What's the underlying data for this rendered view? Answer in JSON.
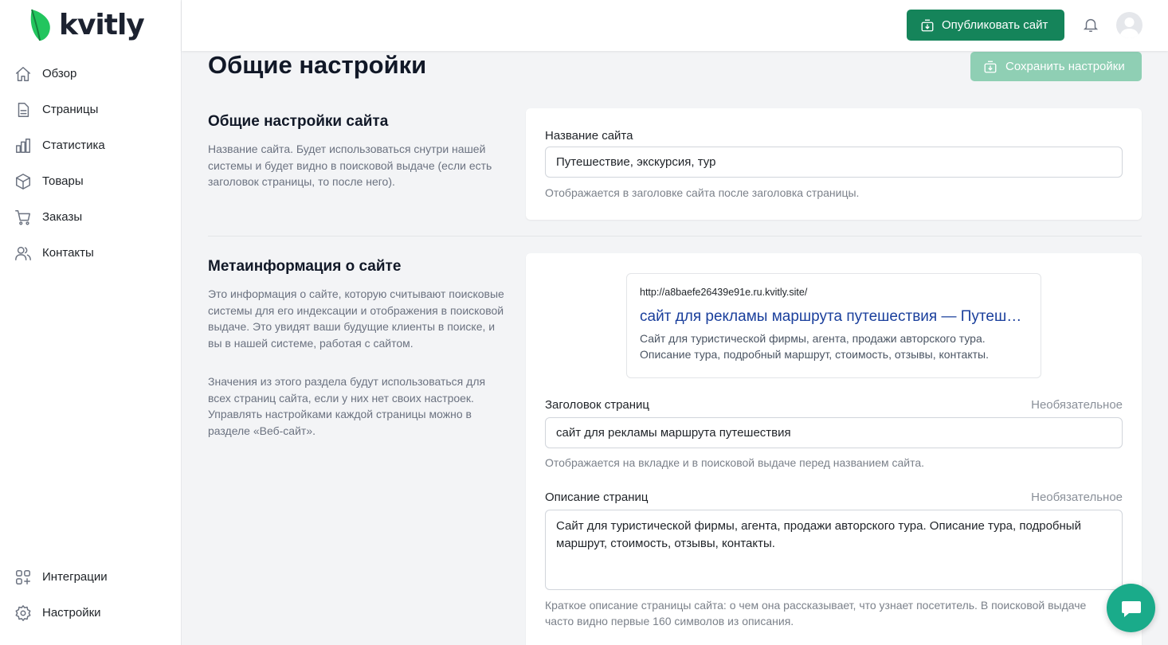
{
  "brand": {
    "name": "kvitly",
    "leaf_color": "#22c55e"
  },
  "sidebar": {
    "items": [
      {
        "label": "Обзор",
        "icon": "home-icon"
      },
      {
        "label": "Страницы",
        "icon": "document-icon"
      },
      {
        "label": "Статистика",
        "icon": "chart-icon"
      },
      {
        "label": "Товары",
        "icon": "box-icon"
      },
      {
        "label": "Заказы",
        "icon": "cart-icon"
      },
      {
        "label": "Контакты",
        "icon": "users-icon"
      }
    ],
    "bottom_items": [
      {
        "label": "Интеграции",
        "icon": "integrations-icon"
      },
      {
        "label": "Настройки",
        "icon": "gear-icon"
      }
    ]
  },
  "topbar": {
    "publish_label": "Опубликовать сайт",
    "accent": "#15845a"
  },
  "page": {
    "title": "Общие настройки",
    "save_label": "Сохранить настройки"
  },
  "general": {
    "title": "Общие настройки сайта",
    "description": "Название сайта. Будет использоваться снутри нашей системы и будет видно в поисковой выдаче (если есть заголовок страницы, то после него).",
    "site_name_label": "Название сайта",
    "site_name_value": "Путешествие, экскурсия, тур",
    "site_name_help": "Отображается в заголовке сайта после заголовка страницы."
  },
  "meta": {
    "title": "Метаинформация о сайте",
    "description_1": "Это информация о сайте, которую считывают поисковые системы для его индексации и отображения в поисковой выдаче. Это увидят ваши будущие клиенты в поиске, и вы в нашей системе, работая с сайтом.",
    "description_2": "Значения из этого раздела будут использоваться для всех страниц сайта, если у них нет своих настроек. Управлять настройками каждой страницы можно в разделе «Веб-сайт».",
    "preview": {
      "url": "http://a8baefe26439e91e.ru.kvitly.site/",
      "title": "сайт для рекламы маршрута путешествия — Путешествие, экскурсия, тур",
      "description": "Сайт для туристической фирмы, агента, продажи авторского тура. Описание тура, подробный маршрут, стоимость, отзывы, контакты."
    },
    "page_title_label": "Заголовок страниц",
    "page_title_optional": "Необязательное",
    "page_title_value": "сайт для рекламы маршрута путешествия",
    "page_title_help": "Отображается на вкладке и в поисковой выдаче перед названием сайта.",
    "page_desc_label": "Описание страниц",
    "page_desc_optional": "Необязательное",
    "page_desc_value": "Сайт для туристической фирмы, агента, продажи авторского тура. Описание тура, подробный маршрут, стоимость, отзывы, контакты.",
    "page_desc_help": "Краткое описание страницы сайта: о чем она рассказывает, что узнает посетитель. В поисковой выдаче часто видно первые 160 символов из описания."
  },
  "chat": {
    "icon": "chat-icon",
    "color": "#1aab8a"
  }
}
